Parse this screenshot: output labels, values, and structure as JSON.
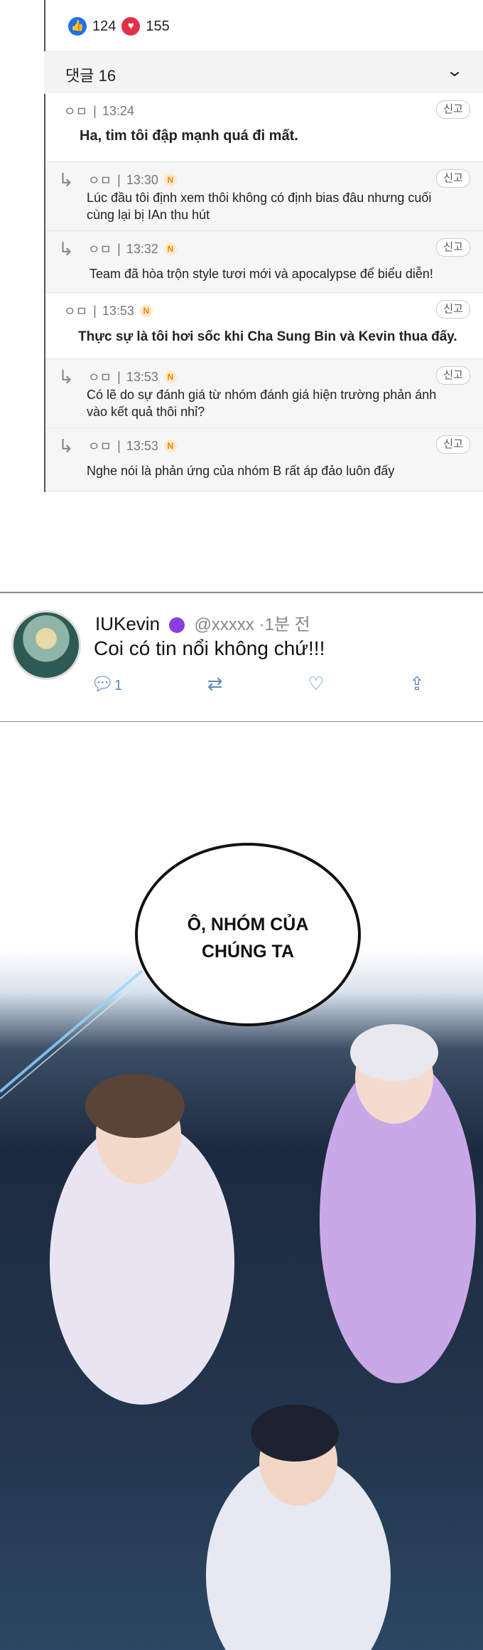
{
  "reactions": {
    "likes": "124",
    "hearts": "155"
  },
  "header": {
    "title": "댓글 16"
  },
  "comments": [
    {
      "user": "ㅇㅁ",
      "time": "13:24",
      "text": "Ha, tim tôi đập mạnh quá đi mất.",
      "report": "신고"
    },
    {
      "user": "ㅇㅁ",
      "time": "13:30",
      "text": "Lúc đầu tôi định xem thôi không có định bias đâu nhưng cuối cùng lại bị IAn thu hút",
      "report": "신고"
    },
    {
      "user": "ㅇㅁ",
      "time": "13:32",
      "text": "Team đã hòa trộn style tươi mới và apocalypse để biểu diễn!",
      "report": "신고"
    },
    {
      "user": "ㅇㅁ",
      "time": "13:53",
      "text": "Thực sự là tôi hơi sốc khi Cha Sung Bin và Kevin thua đấy.",
      "report": "신고"
    },
    {
      "user": "ㅇㅁ",
      "time": "13:53",
      "text": "Có lẽ do sự đánh giá từ nhóm đánh giá hiện trường phản ánh vào kết quả thôi nhỉ?",
      "report": "신고"
    },
    {
      "user": "ㅇㅁ",
      "time": "13:53",
      "text": "Nghe nói là phản ứng của nhóm B rất áp đảo luôn đấy",
      "report": "신고"
    }
  ],
  "tweet": {
    "name": "IUKevin",
    "handle": "@xxxxx ·1분 전",
    "text": "Coi có tin nổi không chứ!!!",
    "replies": "1"
  },
  "scene": {
    "bubble_line1": "Ô, NHÓM CỦA",
    "bubble_line2": "CHÚNG TA"
  }
}
